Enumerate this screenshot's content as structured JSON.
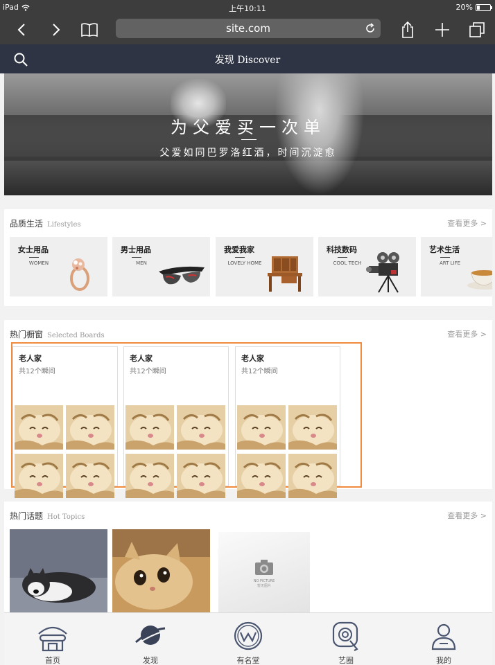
{
  "status": {
    "device": "iPad",
    "time": "上午10:11",
    "battery": "20%"
  },
  "browser": {
    "url": "site.com"
  },
  "header": {
    "title": "发现 Discover"
  },
  "hero": {
    "headline": "为父爱买一次单",
    "subline": "父爱如同巴罗洛红酒，时间沉淀愈"
  },
  "lifestyles": {
    "title": "品质生活",
    "title_en": "Lifestyles",
    "more": "查看更多 >",
    "items": [
      {
        "cn": "女士用品",
        "en": "WOMEN",
        "icon": "ring-icon"
      },
      {
        "cn": "男士用品",
        "en": "MEN",
        "icon": "sunglasses-icon"
      },
      {
        "cn": "我爱我家",
        "en": "LOVELY HOME",
        "icon": "desk-icon"
      },
      {
        "cn": "科技数码",
        "en": "COOL TECH",
        "icon": "camera-projector-icon"
      },
      {
        "cn": "艺术生活",
        "en": "ART LIFE",
        "icon": "teacup-icon"
      }
    ]
  },
  "boards": {
    "title": "热门橱窗",
    "title_en": "Selected Boards",
    "more": "查看更多 >",
    "items": [
      {
        "name": "老人家",
        "count": "共12个瞬间"
      },
      {
        "name": "老人家",
        "count": "共12个瞬间"
      },
      {
        "name": "老人家",
        "count": "共12个瞬间"
      }
    ]
  },
  "topics": {
    "title": "热门话题",
    "title_en": "Hot Topics",
    "more": "查看更多 >",
    "nopic": {
      "line1": "NO PICTURE",
      "line2": "暂无图片"
    }
  },
  "tabs": [
    {
      "label": "首页",
      "icon": "home-icon"
    },
    {
      "label": "发现",
      "icon": "planet-icon"
    },
    {
      "label": "有名堂",
      "icon": "w-circle-icon"
    },
    {
      "label": "艺圈",
      "icon": "art-circle-icon"
    },
    {
      "label": "我的",
      "icon": "person-icon"
    }
  ],
  "colors": {
    "header_bg": "#2e3444",
    "highlight_border": "#f08a3c",
    "chrome_bg": "#3d3d3d"
  }
}
